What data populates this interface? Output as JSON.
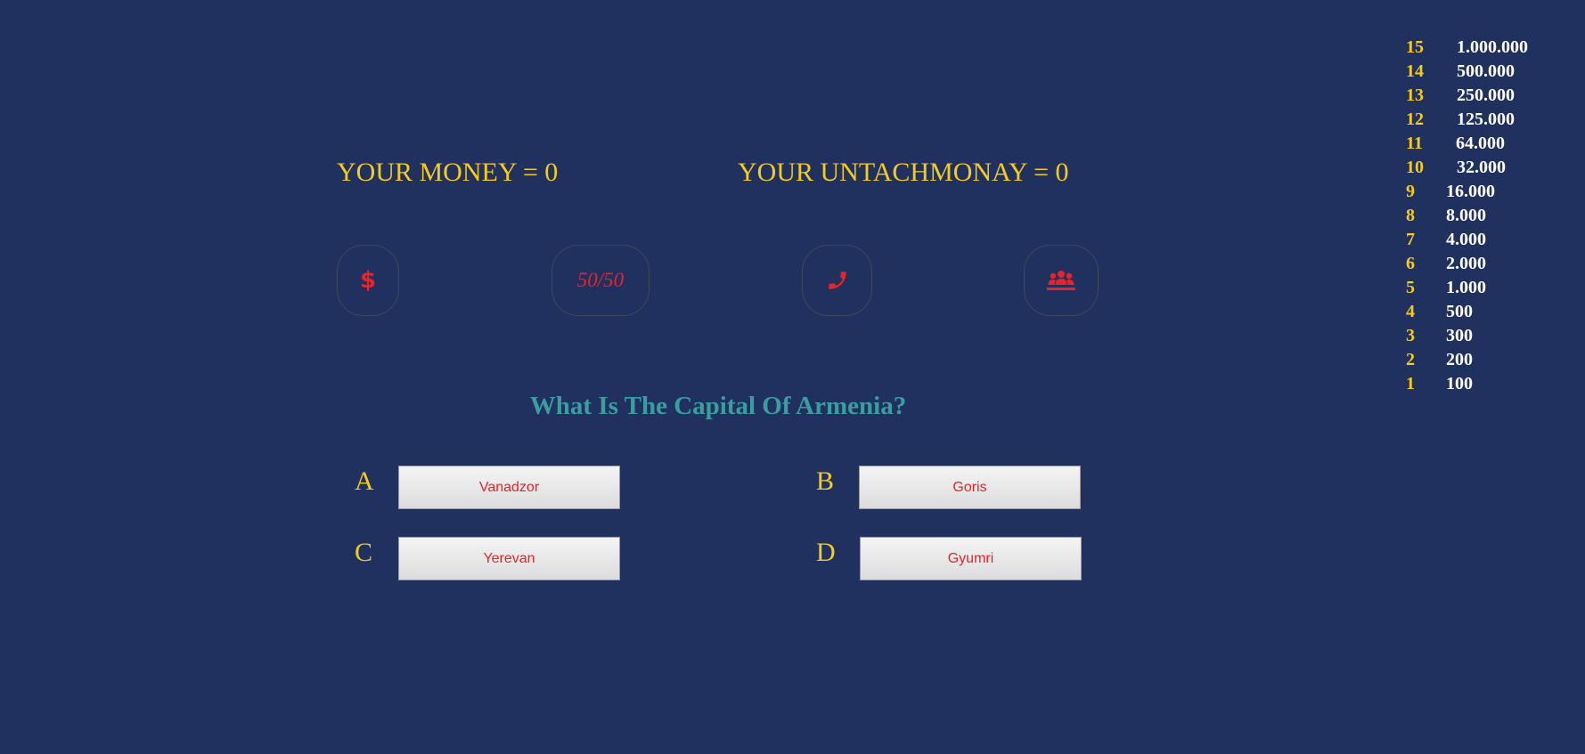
{
  "status": {
    "money_text": "YOUR MONEY = 0",
    "untach_text": "YOUR UNTACHMONAY = 0"
  },
  "lifelines": {
    "money_icon": "$",
    "fifty_label": "50/50",
    "phone_icon": "phone-icon",
    "audience_icon": "users-icon"
  },
  "question": {
    "text": "What Is The Capital Of Armenia?"
  },
  "options": [
    {
      "letter": "A",
      "answer": "Vanadzor"
    },
    {
      "letter": "B",
      "answer": "Goris"
    },
    {
      "letter": "C",
      "answer": "Yerevan"
    },
    {
      "letter": "D",
      "answer": "Gyumri"
    }
  ],
  "ladder": [
    {
      "num": "15",
      "amount": "1.000.000"
    },
    {
      "num": "14",
      "amount": "500.000"
    },
    {
      "num": "13",
      "amount": "250.000"
    },
    {
      "num": "12",
      "amount": "125.000"
    },
    {
      "num": "11",
      "amount": "64.000"
    },
    {
      "num": "10",
      "amount": "32.000"
    },
    {
      "num": "9",
      "amount": "16.000"
    },
    {
      "num": "8",
      "amount": "8.000"
    },
    {
      "num": "7",
      "amount": "4.000"
    },
    {
      "num": "6",
      "amount": "2.000"
    },
    {
      "num": "5",
      "amount": "1.000"
    },
    {
      "num": "4",
      "amount": "500"
    },
    {
      "num": "3",
      "amount": "300"
    },
    {
      "num": "2",
      "amount": "200"
    },
    {
      "num": "1",
      "amount": "100"
    }
  ],
  "colors": {
    "background": "#20305f",
    "gold": "#f5cb1c",
    "red": "#e8232b",
    "teal": "#3a9ea0"
  }
}
